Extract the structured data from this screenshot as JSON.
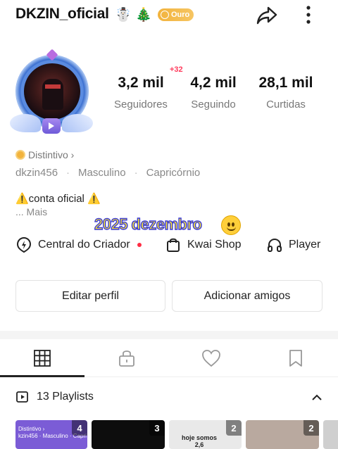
{
  "header": {
    "username": "DKZIN_oficial",
    "emojis": [
      "☃️",
      "🎄"
    ],
    "tier_badge": "Ouro",
    "icons": [
      "share-icon",
      "more-vertical-icon"
    ]
  },
  "profile": {
    "stats": [
      {
        "value": "3,2 mil",
        "label": "Seguidores"
      },
      {
        "value": "4,2 mil",
        "label": "Seguindo"
      },
      {
        "value": "28,1 mil",
        "label": "Curtidas"
      }
    ],
    "new_followers_badge": "+32",
    "distintivo": "Distintivo ›",
    "handle": "dkzin456",
    "gender": "Masculino",
    "sign": "Capricórnio",
    "separator": "·",
    "bio_line": "⚠️conta oficial ⚠️",
    "bio_more": "... Mais",
    "overlay_text": "2025 dezembro"
  },
  "shortcuts": [
    {
      "label": "Central do Criador",
      "icon": "creator-center-icon",
      "has_dot": true
    },
    {
      "label": "Kwai Shop",
      "icon": "shopping-bag-icon"
    },
    {
      "label": "Player",
      "icon": "headphones-icon"
    }
  ],
  "buttons": {
    "edit_profile": "Editar perfil",
    "add_friends": "Adicionar amigos"
  },
  "tabs": [
    {
      "name": "grid",
      "icon": "grid-icon",
      "active": true
    },
    {
      "name": "private",
      "icon": "lock-icon"
    },
    {
      "name": "liked",
      "icon": "heart-icon"
    },
    {
      "name": "saved",
      "icon": "bookmark-icon"
    }
  ],
  "playlists": {
    "label": "13 Playlists",
    "items": [
      {
        "count": "4",
        "color": "#7b5cd6",
        "text": "Distintivo ›\nkzin456 · Masculino · Capri"
      },
      {
        "count": "3",
        "color": "#0d0d0d",
        "text": ""
      },
      {
        "count": "2",
        "color": "#e9e9e9",
        "text": "hoje somos\n2,6"
      },
      {
        "count": "2",
        "color": "#b9a99f",
        "text": ""
      },
      {
        "count": "",
        "color": "#cfcfcf",
        "text": ""
      }
    ]
  },
  "colors": {
    "accent_red": "#ff3b5c",
    "gold": "#f2b33d",
    "text_primary": "#111111",
    "text_secondary": "#777777"
  }
}
